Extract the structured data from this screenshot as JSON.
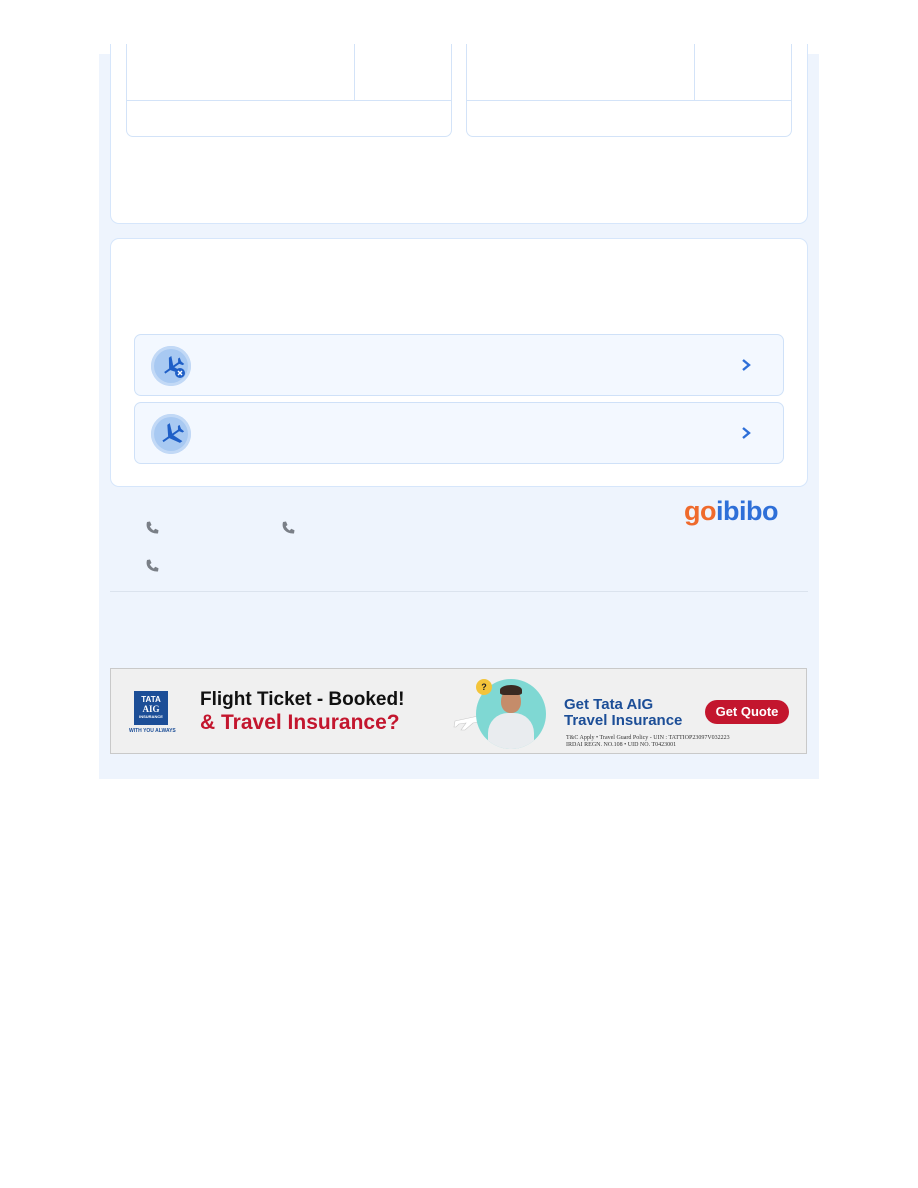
{
  "logo": {
    "part1": "go",
    "part2": "ibibo"
  },
  "banner": {
    "brand_line1": "TATA",
    "brand_line2": "AIG",
    "brand_line3": "INSURANCE",
    "brand_tagline": "WITH YOU ALWAYS",
    "headline1": "Flight Ticket - Booked!",
    "headline2": "& Travel Insurance?",
    "badge": "?",
    "promo_line1": "Get Tata AIG",
    "promo_line2": "Travel Insurance",
    "button_label": "Get Quote",
    "fine_print1": "T&C Apply  •  Travel Guard Policy - UIN : TATTIOP23097V032223",
    "fine_print2": "IRDAI REGN. NO.108  •  UID NO. T0423001"
  },
  "icons": {
    "row1": "plane-cancel-icon",
    "row2": "plane-icon",
    "chevron": "chevron-right-icon",
    "phone": "phone-icon"
  },
  "colors": {
    "accent": "#2e6fd8",
    "brand_orange": "#ef6a2c",
    "insurance_red": "#c3162e",
    "insurance_blue": "#1c4e97"
  }
}
